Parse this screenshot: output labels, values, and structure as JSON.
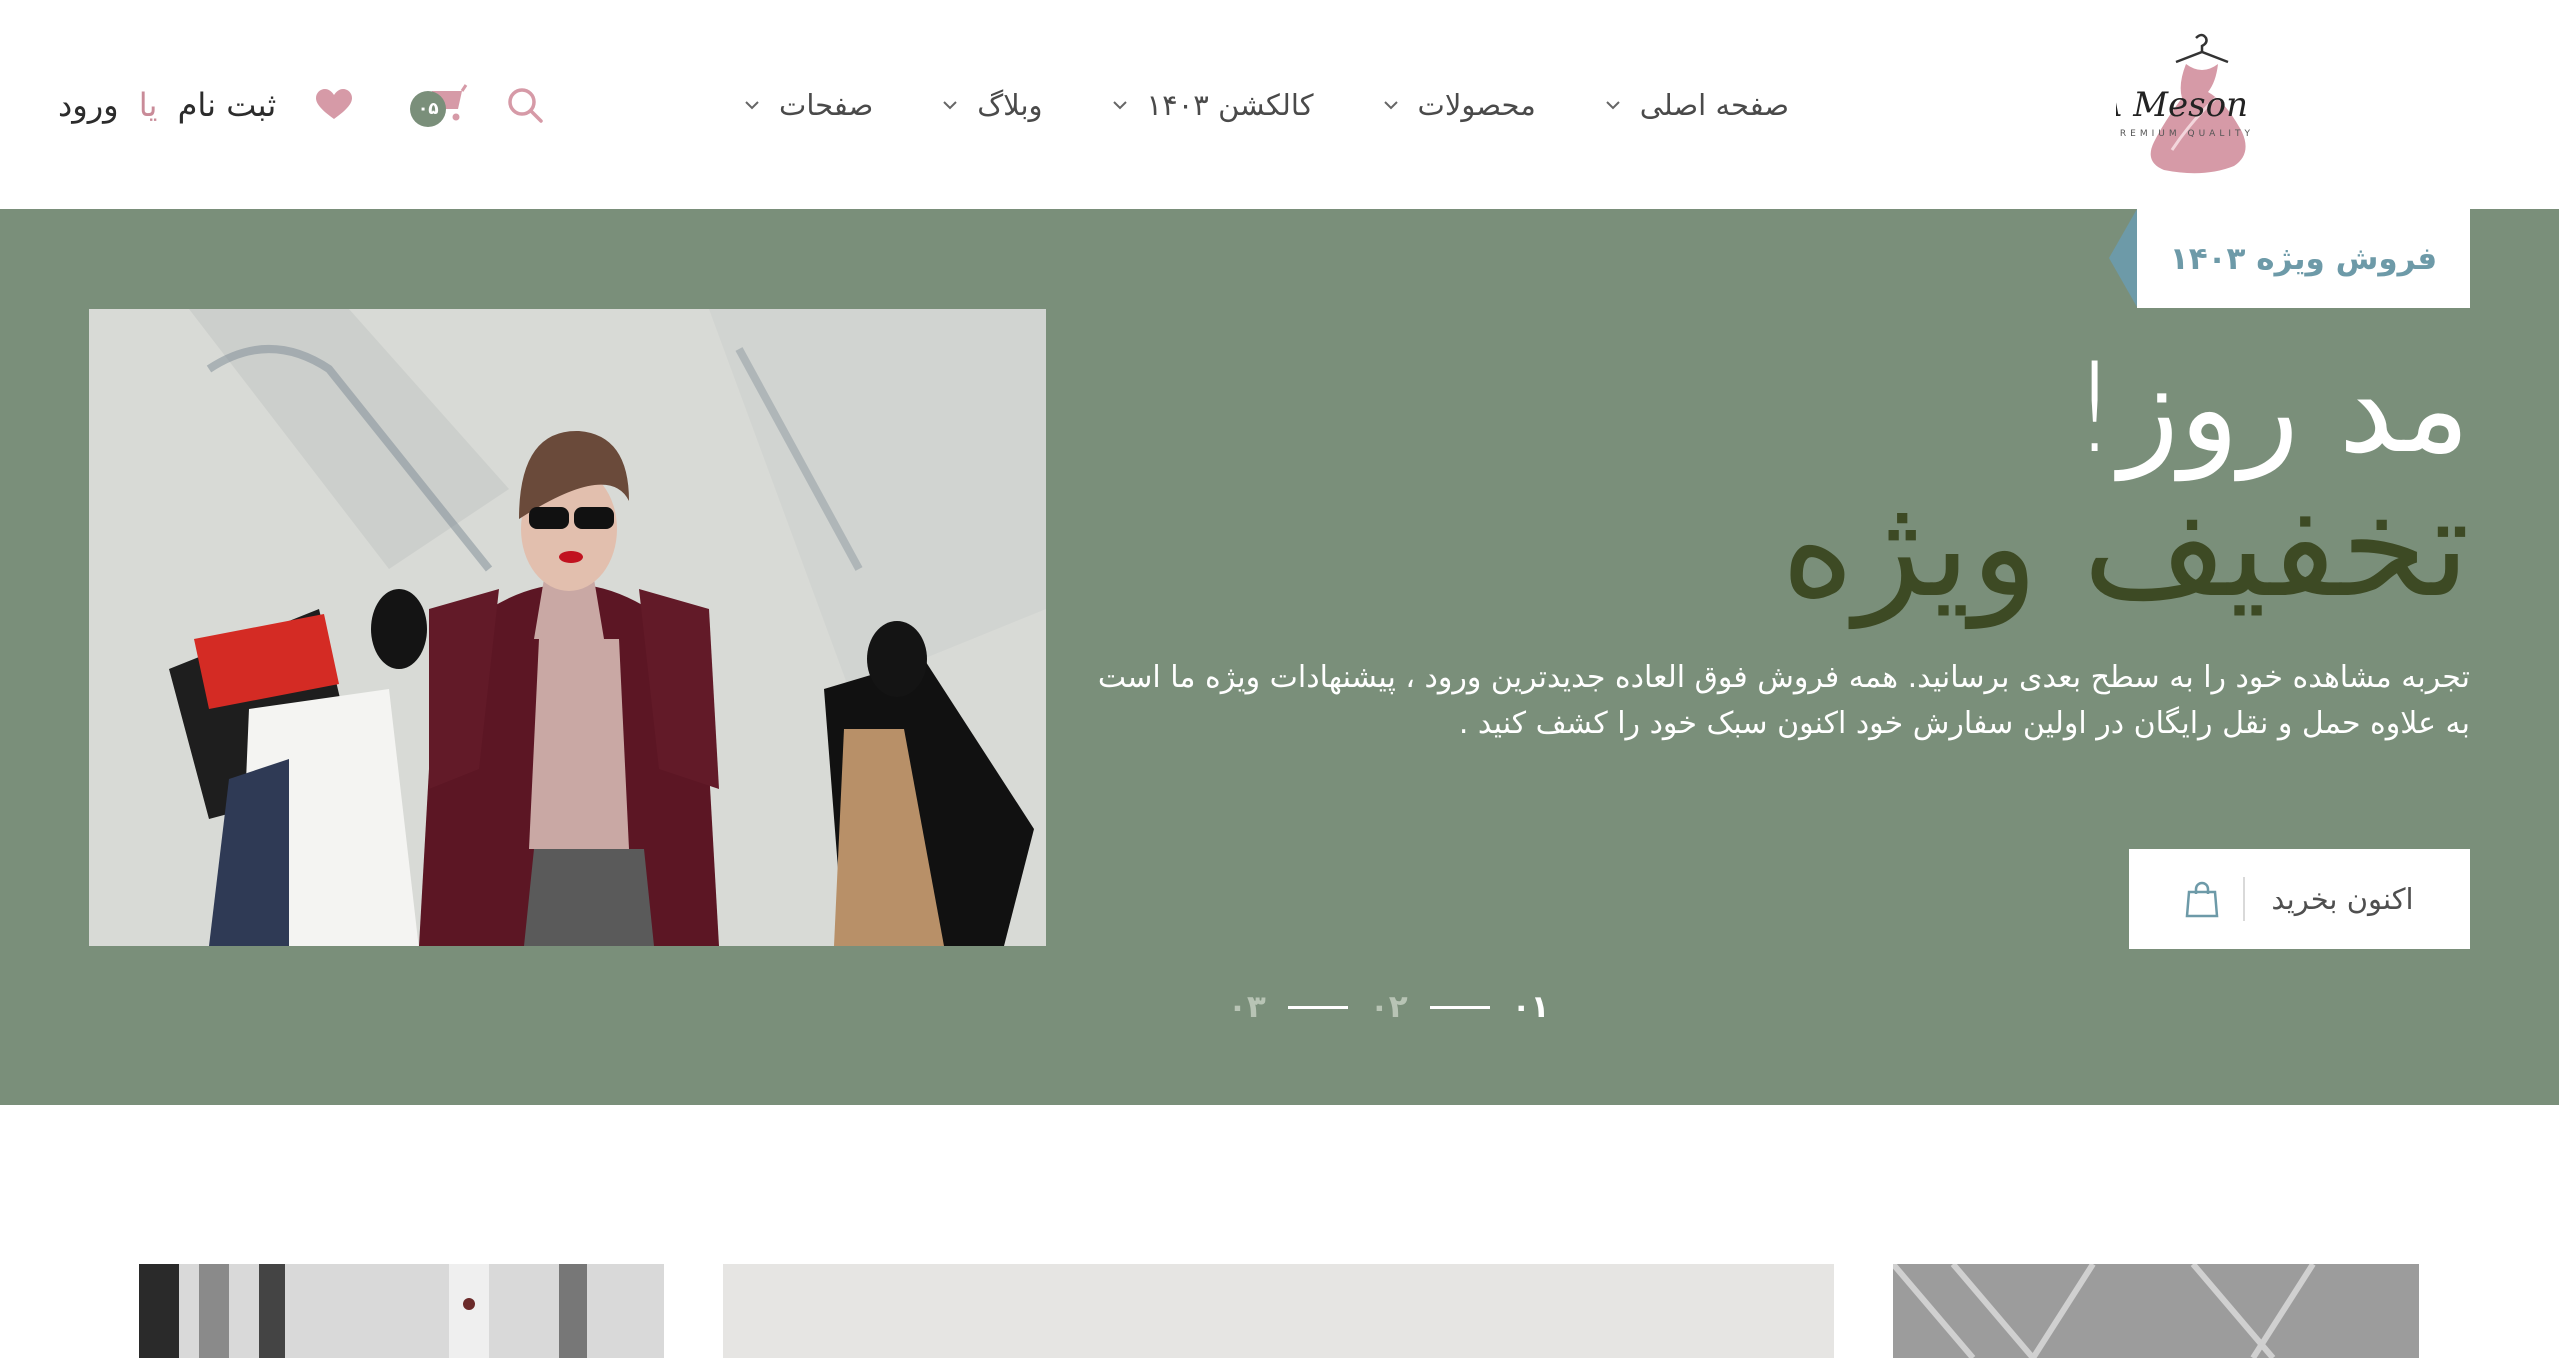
{
  "header": {
    "logo_text": "RASA Meson",
    "logo_subtext": "PREMIUM QUALITY",
    "nav": [
      {
        "label": "صفحه اصلی"
      },
      {
        "label": "محصولات"
      },
      {
        "label": "کالکشن ۱۴۰۳"
      },
      {
        "label": "وبلاگ"
      },
      {
        "label": "صفحات"
      }
    ],
    "auth": {
      "register": "ثبت نام",
      "or": "یا",
      "login": "ورود"
    },
    "cart_count": "۰۵",
    "icons": {
      "wishlist": "heart-icon",
      "cart": "cart-icon",
      "search": "search-icon"
    }
  },
  "hero": {
    "tag": "فروش ویژه ۱۴۰۳",
    "title_line1": "مد روز!",
    "title_line2": "تخفیف ویژه",
    "description_line1": "تجربه مشاهده خود را به سطح بعدی برسانید. همه فروش فوق العاده جدیدترین ورود ، پیشنهادات ویژه ما است",
    "description_line2": "به علاوه حمل و نقل رایگان در اولین سفارش خود اکنون سبک خود را کشف کنید .",
    "cta": "اکنون بخرید",
    "slides": [
      "۰۱",
      "۰۲",
      "۰۳"
    ],
    "active_slide": "۰۱"
  },
  "colors": {
    "hero_bg": "#7a8f7a",
    "title_dark": "#3d4a24",
    "accent_pink": "#c98b98",
    "accent_teal": "#6d9aa8"
  }
}
